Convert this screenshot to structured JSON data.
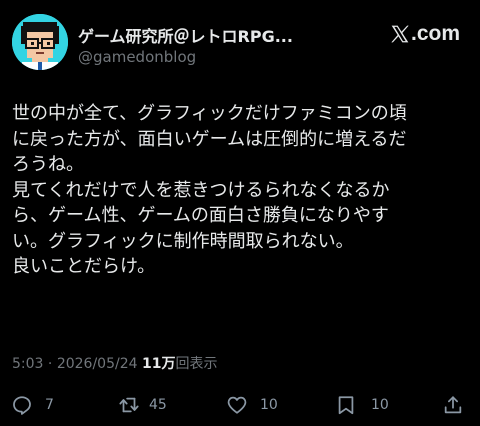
{
  "header": {
    "display_name": "ゲーム研究所＠レトロRPG...",
    "handle": "@gamedonblog",
    "source_label": ".com",
    "avatar_bg": "#33d4e3"
  },
  "tweet": {
    "lines": [
      "世の中が全て、グラフィックだけファミコンの頃",
      "に戻った方が、面白いゲームは圧倒的に増えるだ",
      "ろうね。",
      "見てくれだけで人を惹きつけるられなくなるか",
      "ら、ゲーム性、ゲームの面白さ勝負になりやす",
      "い。グラフィックに制作時間取られない。",
      "良いことだらけ。"
    ]
  },
  "meta": {
    "time": "5:03",
    "separator": " · ",
    "date": "2026/05/24",
    "views_count": "11万",
    "views_label": "回表示"
  },
  "actions": {
    "reply": {
      "icon": "reply-icon",
      "count": "7"
    },
    "retweet": {
      "icon": "retweet-icon",
      "count": "45"
    },
    "like": {
      "icon": "heart-icon",
      "count": "10"
    },
    "bookmark": {
      "icon": "bookmark-icon",
      "count": "10"
    },
    "share": {
      "icon": "share-icon"
    }
  },
  "colors": {
    "background": "#000000",
    "text": "#e7e9ea",
    "secondary_text": "#71767b",
    "icon": "#8b98a5"
  }
}
